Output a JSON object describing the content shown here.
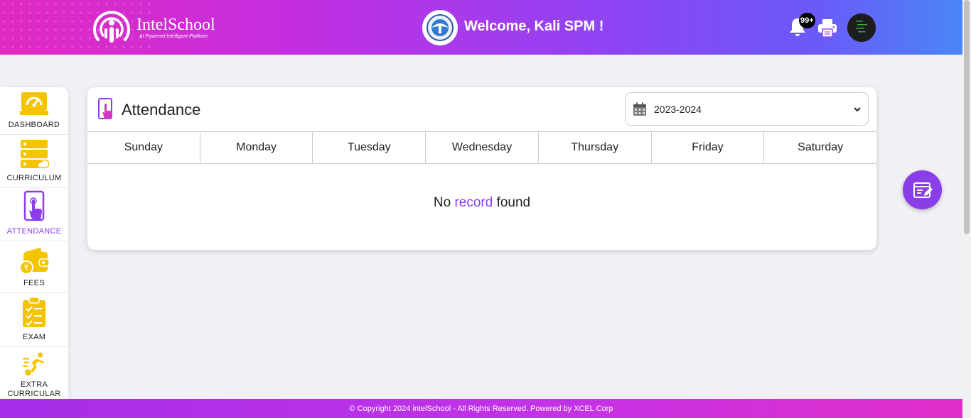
{
  "header": {
    "logo_name": "IntelSchool",
    "logo_tagline": "AI Powered Intelligent Platform",
    "welcome": "Welcome, Kali SPM !",
    "notification_count": "99+"
  },
  "sidebar": {
    "items": [
      {
        "label": "DASHBOARD",
        "icon": "dashboard-gauge-icon"
      },
      {
        "label": "CURRICULUM",
        "icon": "curriculum-server-icon"
      },
      {
        "label": "ATTENDANCE",
        "icon": "attendance-touch-icon",
        "active": true
      },
      {
        "label": "FEES",
        "icon": "wallet-rupee-icon"
      },
      {
        "label": "EXAM",
        "icon": "clipboard-check-icon"
      },
      {
        "label": "EXTRA CURRICULAR",
        "icon": "runner-icon"
      }
    ]
  },
  "card": {
    "title": "Attendance",
    "year_selected": "2023-2024",
    "days": [
      "Sunday",
      "Monday",
      "Tuesday",
      "Wednesday",
      "Thursday",
      "Friday",
      "Saturday"
    ],
    "empty_prefix": "No",
    "empty_highlight": "record",
    "empty_suffix": "found"
  },
  "footer": {
    "text": "© Copyright 2024 intelSchool - All Rights Reserved. Powered by XCEL Corp"
  },
  "colors": {
    "accent": "#8a3ee8",
    "icon_yellow": "#f5c400",
    "header_start": "#e12ac0",
    "header_end": "#4a86f5"
  }
}
